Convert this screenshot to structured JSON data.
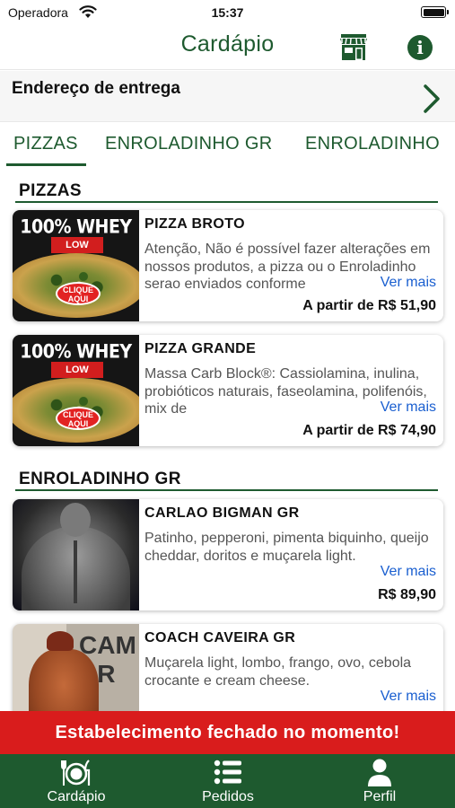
{
  "status_bar": {
    "carrier": "Operadora",
    "time": "15:37"
  },
  "navbar": {
    "title": "Cardápio",
    "store_icon": "store-icon",
    "info_icon": "info-icon"
  },
  "address": {
    "label": "Endereço de entrega",
    "chevron_icon": "chevron-right-icon"
  },
  "tabs": [
    {
      "label": "PIZZAS",
      "active": true
    },
    {
      "label": "ENROLADINHO GR",
      "active": false
    },
    {
      "label": "ENROLADINHO",
      "active": false
    }
  ],
  "sections": [
    {
      "title": "PIZZAS",
      "items": [
        {
          "name": "PIZZA BROTO",
          "description": "Atenção, Não é possível fazer alterações em nossos produtos, a pizza ou o Enroladinho serao  enviados conforme",
          "more": "Ver mais",
          "price": "A partir de R$ 51,90",
          "image_text": {
            "headline": "100% WHEY",
            "tag": "LOW CARB",
            "cta": "CLIQUE AQUI"
          }
        },
        {
          "name": "PIZZA GRANDE",
          "description": "Massa Carb Block®:   Cassiolamina, inulina, probióticos naturais, faseolamina, polifenóis, mix de",
          "more": "Ver mais",
          "price": "A partir de R$ 74,90",
          "image_text": {
            "headline": "100% WHEY",
            "tag": "LOW CARB",
            "cta": "CLIQUE AQUI"
          }
        }
      ]
    },
    {
      "title": "ENROLADINHO GR",
      "items": [
        {
          "name": "CARLAO BIGMAN GR",
          "description": "Patinho, pepperoni, pimenta biquinho, queijo cheddar, doritos e muçarela light.",
          "more": "Ver mais",
          "price": "R$ 89,90"
        },
        {
          "name": "COACH CAVEIRA GR",
          "description": "Muçarela light, lombo, frango, ovo, cebola crocante e cream cheese.",
          "more": "Ver mais",
          "image_text": {
            "banner": "CAM AR"
          }
        }
      ]
    }
  ],
  "closed_banner": "Estabelecimento fechado no momento!",
  "tabbar": [
    {
      "label": "Cardápio",
      "icon": "cutlery-plate-icon"
    },
    {
      "label": "Pedidos",
      "icon": "list-icon"
    },
    {
      "label": "Perfil",
      "icon": "person-icon"
    }
  ],
  "colors": {
    "primary": "#1e5a2f",
    "banner": "#d91c1c",
    "link": "#1a5fd0"
  }
}
